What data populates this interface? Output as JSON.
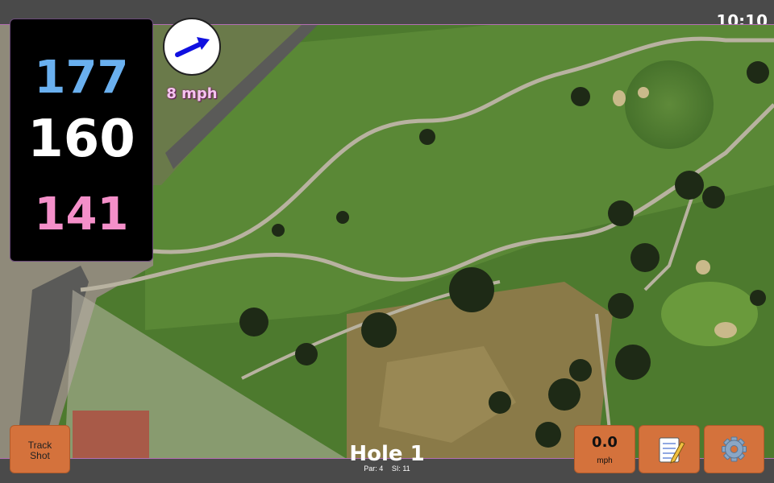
{
  "status_bar": {
    "time": "10:10"
  },
  "distances": {
    "back": "177",
    "center": "160",
    "front": "141"
  },
  "wind": {
    "speed_label": "8 mph",
    "arrow_icon": "wind-direction-arrow-icon"
  },
  "hole": {
    "title": "Hole 1",
    "par_label": "Par: 4",
    "si_label": "SI: 11"
  },
  "buttons": {
    "track_shot_line1": "Track",
    "track_shot_line2": "Shot",
    "speed_value": "0.0",
    "speed_unit": "mph",
    "notes_icon": "notepad-icon",
    "settings_icon": "gear-icon"
  },
  "colors": {
    "back": "#6ab0ef",
    "center": "#ffffff",
    "front": "#f48fc9",
    "button": "#d4723c",
    "wind_text": "#f5c4ef"
  }
}
